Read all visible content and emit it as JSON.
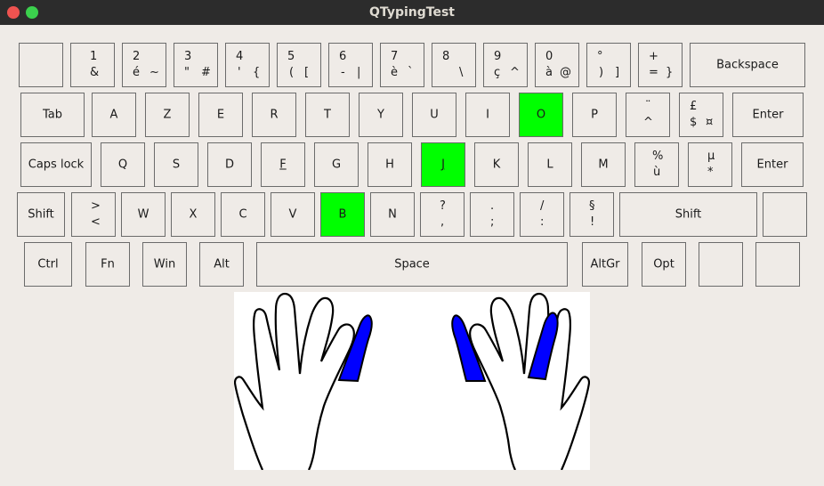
{
  "window": {
    "title": "QTypingTest"
  },
  "keyboard": {
    "row1": {
      "k0": "",
      "k1": {
        "top": "1",
        "bot1": "&",
        "bot2": ""
      },
      "k2": {
        "top": "2",
        "bot1": "é",
        "bot2": "~"
      },
      "k3": {
        "top": "3",
        "bot1": "\"",
        "bot2": "#"
      },
      "k4": {
        "top": "4",
        "bot1": "'",
        "bot2": "{"
      },
      "k5": {
        "top": "5",
        "bot1": "(",
        "bot2": "["
      },
      "k6": {
        "top": "6",
        "bot1": "-",
        "bot2": "|"
      },
      "k7": {
        "top": "7",
        "bot1": "è",
        "bot2": "`"
      },
      "k8": {
        "top": "8",
        "bot1": "",
        "bot2": "\\"
      },
      "k9": {
        "top": "9",
        "bot1": "ç",
        "bot2": "^"
      },
      "k10": {
        "top": "0",
        "bot1": "à",
        "bot2": "@"
      },
      "k11": {
        "top": "°",
        "bot1": ")",
        "bot2": "]"
      },
      "k12": {
        "top": "+",
        "bot1": "=",
        "bot2": "}"
      },
      "backspace": "Backspace"
    },
    "row2": {
      "tab": "Tab",
      "a": "A",
      "z": "Z",
      "e": "E",
      "r": "R",
      "t": "T",
      "y": "Y",
      "u": "U",
      "i": "I",
      "o": "O",
      "p": "P",
      "diaeresis": {
        "top": "¨",
        "bot": "^"
      },
      "pound": {
        "top": "£",
        "bot1": "$",
        "bot2": "¤"
      },
      "enter": "Enter"
    },
    "row3": {
      "caps": "Caps lock",
      "q": "Q",
      "s": "S",
      "d": "D",
      "f": "F",
      "g": "G",
      "h": "H",
      "j": "J",
      "k": "K",
      "l": "L",
      "m": "M",
      "percent": {
        "top": "%",
        "bot": "ù"
      },
      "micro": {
        "top": "µ",
        "bot": "*"
      },
      "enter": "Enter"
    },
    "row4": {
      "shift_left": "Shift",
      "angle": {
        "top": ">",
        "bot": "<"
      },
      "w": "W",
      "x": "X",
      "c": "C",
      "v": "V",
      "b": "B",
      "n": "N",
      "question": {
        "top": "?",
        "bot": ","
      },
      "period": {
        "top": ".",
        "bot": ";"
      },
      "slash": {
        "top": "/",
        "bot": ":"
      },
      "section": {
        "top": "§",
        "bot": "!"
      },
      "shift_right": "Shift",
      "extra": ""
    },
    "row5": {
      "ctrl": "Ctrl",
      "fn": "Fn",
      "win": "Win",
      "alt": "Alt",
      "space": "Space",
      "altgr": "AltGr",
      "opt": "Opt",
      "blank1": "",
      "blank2": ""
    },
    "highlighted_keys": [
      "O",
      "J",
      "B"
    ],
    "highlight_color": "#00ff00"
  },
  "hands": {
    "highlighted_fingers": [
      "left-index",
      "right-index",
      "right-middle"
    ],
    "finger_color": "#0000ff"
  }
}
